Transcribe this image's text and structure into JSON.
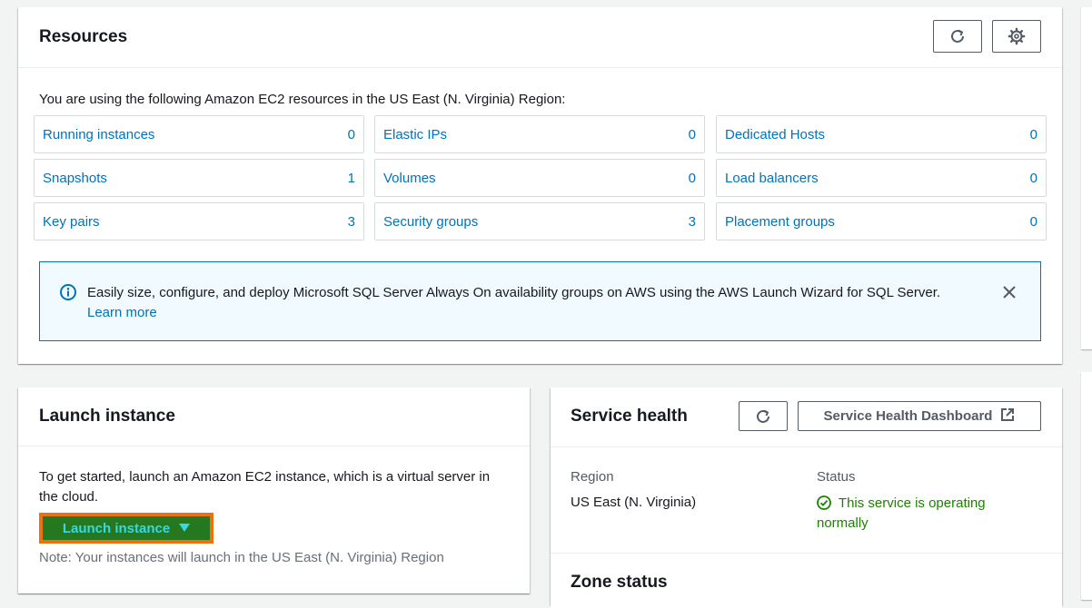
{
  "resources": {
    "title": "Resources",
    "intro": "You are using the following Amazon EC2 resources in the US East (N. Virginia) Region:",
    "items": [
      {
        "label": "Running instances",
        "count": "0"
      },
      {
        "label": "Elastic IPs",
        "count": "0"
      },
      {
        "label": "Dedicated Hosts",
        "count": "0"
      },
      {
        "label": "Snapshots",
        "count": "1"
      },
      {
        "label": "Volumes",
        "count": "0"
      },
      {
        "label": "Load balancers",
        "count": "0"
      },
      {
        "label": "Key pairs",
        "count": "3"
      },
      {
        "label": "Security groups",
        "count": "3"
      },
      {
        "label": "Placement groups",
        "count": "0"
      }
    ],
    "info": {
      "text": "Easily size, configure, and deploy Microsoft SQL Server Always On availability groups on AWS using the AWS Launch Wizard for SQL Server.",
      "link": "Learn more"
    },
    "icons": {
      "refresh": "refresh-icon",
      "settings": "gear-icon",
      "info": "info-icon",
      "close": "close-icon"
    }
  },
  "launch": {
    "title": "Launch instance",
    "description": "To get started, launch an Amazon EC2 instance, which is a virtual server in the cloud.",
    "button_label": "Launch instance",
    "note": "Note: Your instances will launch in the US East (N. Virginia) Region",
    "icons": {
      "dropdown": "caret-down-icon"
    }
  },
  "service_health": {
    "title": "Service health",
    "dashboard_button": "Service Health Dashboard",
    "region_label": "Region",
    "region_value": "US East (N. Virginia)",
    "status_label": "Status",
    "status_value": "This service is operating normally",
    "zone_title": "Zone status",
    "icons": {
      "refresh": "refresh-icon",
      "external": "external-link-icon",
      "status": "check-circle-icon"
    }
  },
  "colors": {
    "link": "#0073bb",
    "success": "#1d8102",
    "info_border": "#0073bb",
    "info_bg": "#f1faff",
    "launch_outline": "#ec7211",
    "launch_fill": "#257820",
    "launch_text": "#38d8e0"
  }
}
